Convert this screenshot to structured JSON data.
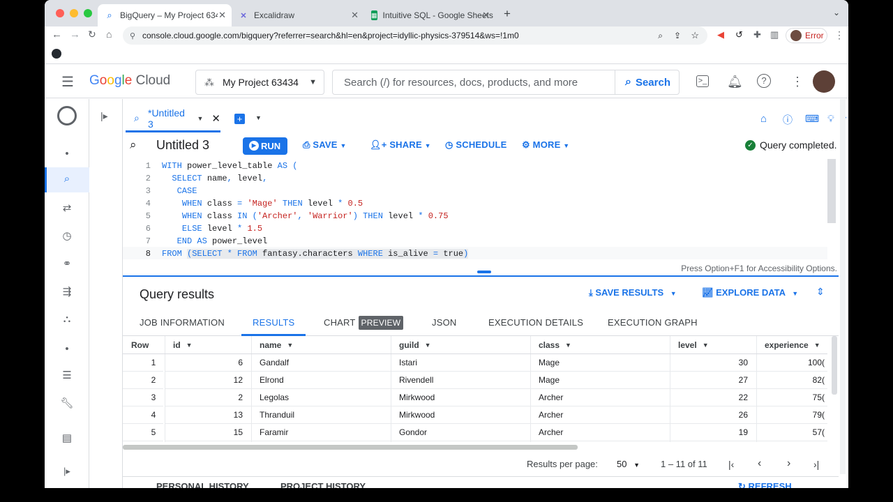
{
  "browser": {
    "tabs": [
      {
        "label": "BigQuery – My Project 63434"
      },
      {
        "label": "Excalidraw"
      },
      {
        "label": "Intuitive SQL - Google Sheets"
      }
    ],
    "url": "console.cloud.google.com/bigquery?referrer=search&hl=en&project=idyllic-physics-379514&ws=!1m0",
    "profile_status": "Error"
  },
  "header": {
    "logo": "Google Cloud",
    "project": "My Project 63434",
    "search_placeholder": "Search (/) for resources, docs, products, and more",
    "search_button": "Search"
  },
  "editor": {
    "tab_label": "*Untitled 3",
    "title": "Untitled 3",
    "run": "RUN",
    "save": "SAVE",
    "share": "SHARE",
    "schedule": "SCHEDULE",
    "more": "MORE",
    "status": "Query completed.",
    "accessibility_hint": "Press Option+F1 for Accessibility Options.",
    "line_numbers": [
      "1",
      "2",
      "3",
      "4",
      "5",
      "6",
      "7",
      "8"
    ],
    "code_lines": [
      "WITH power_level_table AS (",
      "  SELECT name, level,",
      "   CASE",
      "    WHEN class = 'Mage' THEN level * 0.5",
      "    WHEN class IN ('Archer', 'Warrior') THEN level * 0.75",
      "    ELSE level * 1.5",
      "   END AS power_level",
      "FROM (SELECT * FROM fantasy.characters WHERE is_alive = true)"
    ]
  },
  "results": {
    "title": "Query results",
    "save_results": "SAVE RESULTS",
    "explore_data": "EXPLORE DATA",
    "tabs": [
      "JOB INFORMATION",
      "RESULTS",
      "CHART",
      "JSON",
      "EXECUTION DETAILS",
      "EXECUTION GRAPH"
    ],
    "preview_badge": "PREVIEW",
    "columns": [
      "Row",
      "id",
      "name",
      "guild",
      "class",
      "level",
      "experience"
    ],
    "rows": [
      [
        "1",
        "6",
        "Gandalf",
        "Istari",
        "Mage",
        "30",
        "100("
      ],
      [
        "2",
        "12",
        "Elrond",
        "Rivendell",
        "Mage",
        "27",
        "82("
      ],
      [
        "3",
        "2",
        "Legolas",
        "Mirkwood",
        "Archer",
        "22",
        "75("
      ],
      [
        "4",
        "13",
        "Thranduil",
        "Mirkwood",
        "Archer",
        "26",
        "79("
      ],
      [
        "5",
        "15",
        "Faramir",
        "Gondor",
        "Archer",
        "19",
        "57("
      ]
    ],
    "per_page_label": "Results per page:",
    "per_page_value": "50",
    "range": "1 – 11 of 11"
  },
  "bottom": {
    "personal_history": "PERSONAL HISTORY",
    "project_history": "PROJECT HISTORY",
    "refresh": "REFRESH"
  },
  "colors": {
    "accent": "#1a73e8",
    "success": "#188038"
  }
}
